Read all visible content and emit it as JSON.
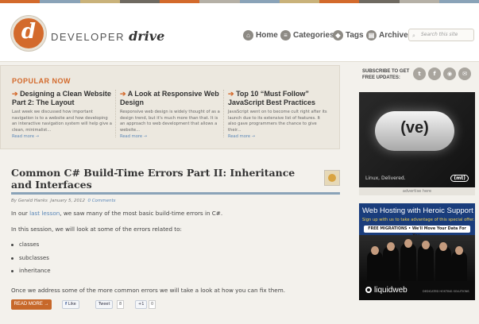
{
  "site": {
    "stripe_colors": [
      "#d36a2c",
      "#8aa3b8",
      "#c9b27a",
      "#6f6a61",
      "#d36a2c",
      "#b5b0a6",
      "#8aa3b8",
      "#c9b27a",
      "#d36a2c",
      "#6f6a61",
      "#b5b0a6",
      "#8aa3b8"
    ],
    "logo_letter": "d",
    "logo_word": "DEVELOPER",
    "logo_word_script": "drive",
    "accent_color": "#d36a2c",
    "link_color": "#5a87b8"
  },
  "nav": {
    "items": [
      {
        "label": "Home",
        "icon": "home-icon"
      },
      {
        "label": "Categories",
        "icon": "list-icon"
      },
      {
        "label": "Tags",
        "icon": "tag-icon"
      },
      {
        "label": "Archive",
        "icon": "archive-icon"
      }
    ],
    "search_placeholder": "Search this site"
  },
  "popular": {
    "title": "POPULAR NOW",
    "items": [
      {
        "title": "Designing a Clean Website Part 2: The Layout",
        "excerpt": "Last week we discussed how important navigation is to a website and how developing an interactive navigation system will help give a clean, minimalist...",
        "more": "Read more →"
      },
      {
        "title": "A Look at Responsive Web Design",
        "excerpt": "Responsive web design is widely thought of as a design trend, but it's much more than that. It is an approach to web development that allows a website...",
        "more": "Read more →"
      },
      {
        "title": "Top 10 “Must Follow” JavaScript Best Practices",
        "excerpt": "JavaScript went on to become cult right after its launch due to its extensive list of features. It also gave programmers the chance to give their...",
        "more": "Read more →"
      }
    ]
  },
  "post": {
    "title": "Common C# Build-Time Errors Part II: Inheritance and Interfaces",
    "author": "By Gerald Hanks",
    "date": "January 5, 2012",
    "comments": "0 Comments",
    "p1_before": "In our ",
    "p1_link": "last lesson",
    "p1_after": ", we saw many of the most basic build-time errors in C#.",
    "p2": "In this session, we will look at some of the errors related to:",
    "bullets": [
      "classes",
      "subclasses",
      "inheritance"
    ],
    "p3": "Once we address some of the more common errors we will take a look at how you can fix them.",
    "read_more": "READ MORE →",
    "like_label": "Like",
    "tweet_label": "Tweet",
    "tweet_count": "8",
    "plus_label": "+1",
    "plus_count": "0"
  },
  "sidebar": {
    "subscribe_text": "SUBSCRIBE TO GET FREE UPDATES:",
    "icons": [
      "twitter-icon",
      "facebook-icon",
      "rss-icon",
      "email-icon"
    ],
    "ad1": {
      "brand_mark": "(ve)",
      "tagline": "Linux, Delivered.",
      "logo": "(mt)",
      "caption": "advertise here"
    },
    "ad2": {
      "headline": "Web Hosting with Heroic Support",
      "subline": "Sign up with us to take advantage of this special offer.",
      "bar": "FREE MIGRATIONS • We'll Move Your Data For You.",
      "brand": "liquidweb",
      "slogan": "DEDICATED HOSTING SOLUTIONS"
    }
  }
}
